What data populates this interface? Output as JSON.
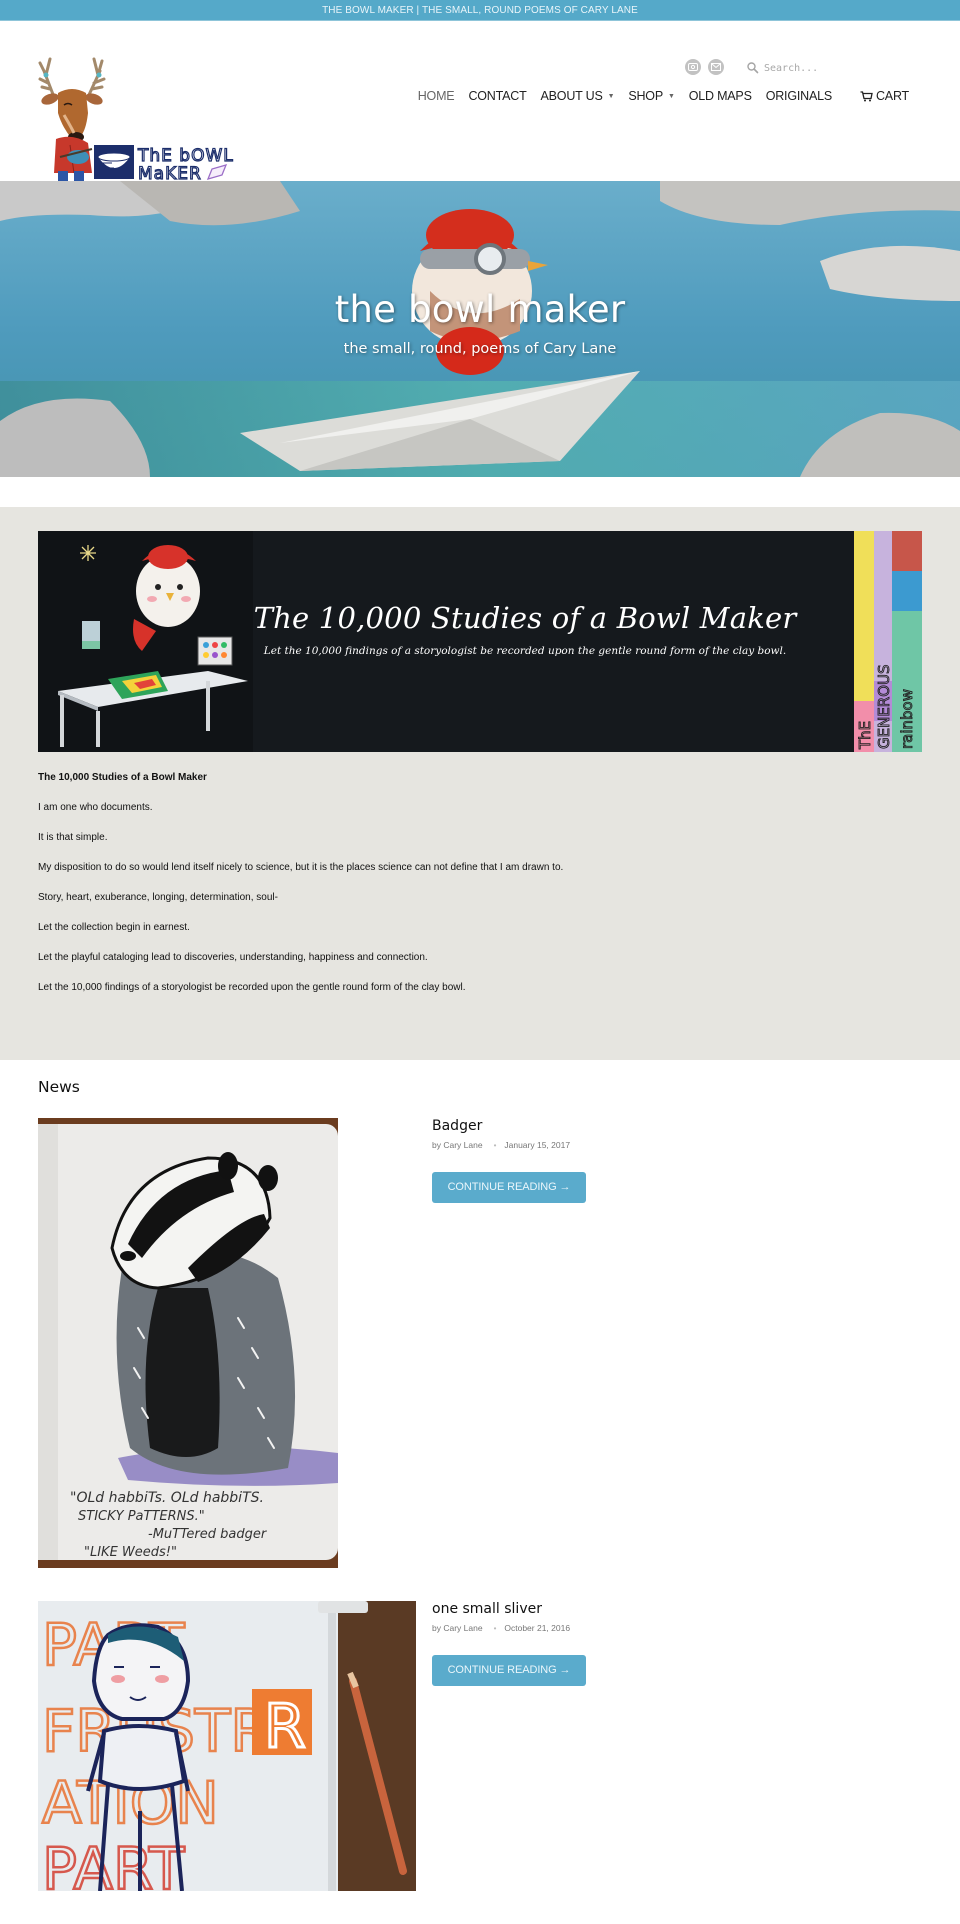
{
  "announcement": "THE BOWL MAKER | THE SMALL, ROUND POEMS OF CARY LANE",
  "header": {
    "logo_text": [
      "ThE bOWL",
      "MaKER"
    ],
    "logo_alt": "The Bowl Maker",
    "social_icons": [
      "instagram-icon",
      "email-icon"
    ],
    "search": {
      "placeholder": "Search...",
      "value": "",
      "icon": "search-icon"
    }
  },
  "nav": {
    "items": [
      {
        "label": "HOME",
        "active": true,
        "dropdown": false
      },
      {
        "label": "CONTACT",
        "active": false,
        "dropdown": false
      },
      {
        "label": "ABOUT US",
        "active": false,
        "dropdown": true
      },
      {
        "label": "SHOP",
        "active": false,
        "dropdown": true
      },
      {
        "label": "OLD MAPS",
        "active": false,
        "dropdown": false
      },
      {
        "label": "ORIGINALS",
        "active": false,
        "dropdown": false
      }
    ],
    "caret": "▼",
    "cart": {
      "label": "CART",
      "icon": "cart-icon"
    }
  },
  "hero": {
    "title": "the bowl maker",
    "subtitle": "the small, round, poems of Cary Lane"
  },
  "featured": {
    "banner": {
      "title": "The 10,000 Studies of a Bowl Maker",
      "subtitle": "Let the 10,000 findings of a storyologist be recorded upon the gentle round form of the clay bowl.",
      "side_text": [
        "ThE",
        "GENEROUS",
        "rainbow"
      ]
    },
    "article_title": "The 10,000 Studies of a Bowl Maker",
    "paragraphs": [
      "I am one who documents.",
      "It is that simple.",
      "My disposition to do so would lend itself nicely to science, but it is the places science can not define that I am drawn to.",
      "Story, heart, exuberance, longing, determination, soul-",
      "Let the collection begin in earnest.",
      "Let the playful cataloging lead to discoveries, understanding, happiness and connection.",
      "Let the 10,000 findings of a storyologist be recorded upon the gentle round form of the clay bowl."
    ]
  },
  "news": {
    "heading": "News",
    "posts": [
      {
        "title": "Badger",
        "author": "by Cary Lane",
        "separator": "•",
        "date": "January 15, 2017",
        "button": "CONTINUE READING →",
        "image_caption": [
          "\"OLd habbiTs. OLd habbiTS.",
          "STICKY PaTTERNS.\"",
          "-MuTTered badger",
          "\"LIKE Weeds!\""
        ]
      },
      {
        "title": "one small sliver",
        "author": "by Cary Lane",
        "separator": "•",
        "date": "October 21, 2016",
        "button": "CONTINUE READING →",
        "image_caption": [
          "PART",
          "FRUSTR",
          "ATION",
          "PART"
        ]
      }
    ]
  },
  "colors": {
    "accent": "#55a9c9",
    "button": "#5aabcc",
    "featured_bg": "#e6e5e0",
    "banner_bg": "#15191d"
  }
}
